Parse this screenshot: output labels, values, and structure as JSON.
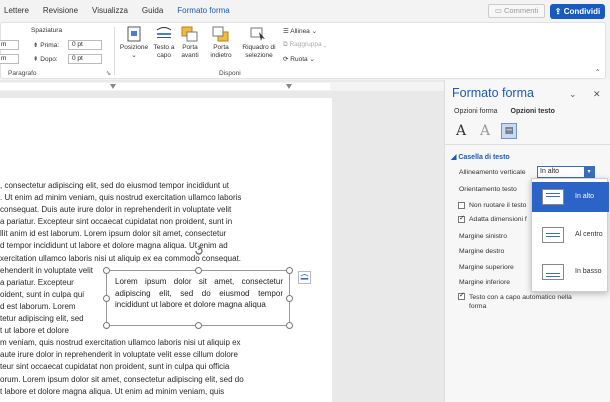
{
  "menubar": {
    "tabs": [
      "Lettere",
      "Revisione",
      "Visualizza",
      "Guida",
      "Formato forma"
    ],
    "comments_label": "Commenti",
    "share_label": "Condividi"
  },
  "ribbon": {
    "spacing_label": "Spaziatura",
    "before_label": "Prima:",
    "before_value": "0 pt",
    "after_label": "Dopo:",
    "after_value": "0 pt",
    "indent_left_value": "m",
    "indent_right_value": "m",
    "paragraph_label": "Paragrafo",
    "position_label": "Posizione",
    "wrap_label": "Testo a capo",
    "forward_label": "Porta avanti",
    "backward_label": "Porta indietro",
    "selection_pane_label": "Riquadro di selezione",
    "align_label": "Allinea",
    "group_label": "Raggruppa",
    "rotate_label": "Ruota",
    "arrange_label": "Disponi"
  },
  "document": {
    "lines": [
      ", consectetur adipiscing elit, sed do eiusmod tempor incididunt ut",
      ". Ut enim ad minim veniam, quis nostrud exercitation ullamco laboris",
      "consequat. Duis aute irure dolor in reprehenderit in voluptate velit",
      "a pariatur. Excepteur sint occaecat cupidatat non proident, sunt in",
      "llit anim id est laborum. Lorem ipsum dolor sit amet, consectetur",
      "d tempor incididunt ut labore et dolore magna aliqua. Ut enim ad",
      "xercitation ullamco laboris nisi ut aliquip ex ea commodo consequat.",
      "ehenderit in voluptate velit",
      "a pariatur. Excepteur",
      "oident, sunt in culpa qui",
      "d est laborum. Lorem",
      "tetur adipiscing elit, sed",
      "t ut labore et dolore",
      "m veniam, quis nostrud exercitation ullamco laboris nisi ut aliquip ex",
      "aute irure dolor in reprehenderit in voluptate velit esse cillum dolore",
      "teur sint occaecat cupidatat non proident, sunt in culpa qui officia",
      "orum. Lorem ipsum dolor sit amet, consectetur adipiscing elit, sed do",
      "t labore et dolore magna aliqua. Ut enim ad minim veniam, quis"
    ],
    "textbox_text": "Lorem ipsum dolor sit amet, consectetur adipiscing elit, sed do eiusmod tempor incididunt ut labore et dolore magna aliqua"
  },
  "pane": {
    "title": "Formato forma",
    "tab_shape": "Opzioni forma",
    "tab_text": "Opzioni testo",
    "section_title": "Casella di testo",
    "vertical_align_label": "Allineamento verticale",
    "vertical_align_value": "In alto",
    "orientation_label": "Orientamento testo",
    "no_rotate_label": "Non ruotare il testo",
    "autofit_label": "Adatta dimensioni f",
    "margin_left_label": "Margine sinistro",
    "margin_right_label": "Margine destro",
    "margin_top_label": "Margine superiore",
    "margin_bottom_label": "Margine inferiore",
    "wrap_text_label": "Testo con a capo automatico nella forma",
    "options": [
      "In alto",
      "Al centro",
      "In basso"
    ]
  },
  "colors": {
    "accent": "#185abd",
    "selected": "#2b63c6"
  }
}
